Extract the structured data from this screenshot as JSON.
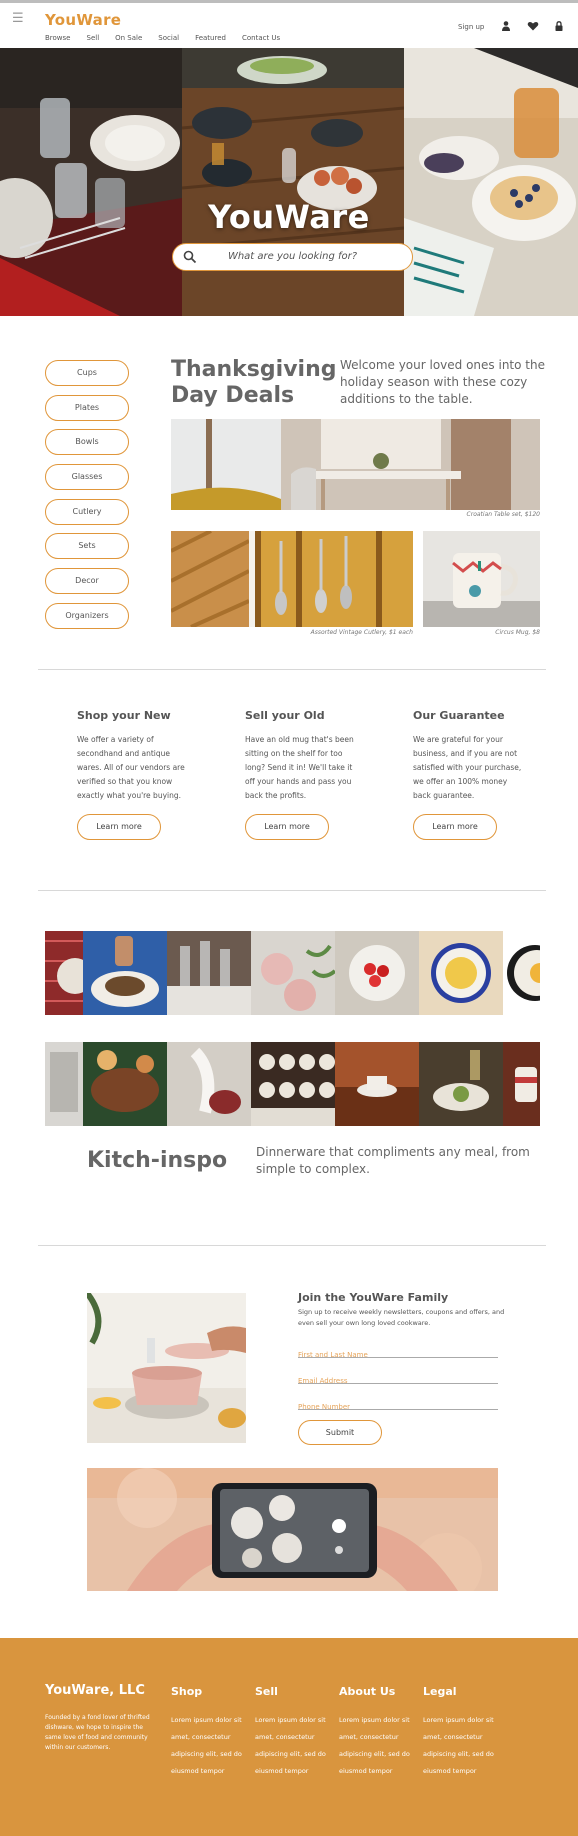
{
  "header": {
    "logo": "YouWare",
    "nav": [
      "Browse",
      "Sell",
      "On Sale",
      "Social",
      "Featured",
      "Contact Us"
    ],
    "signup": "Sign up",
    "icons": [
      "menu-icon",
      "user-icon",
      "heart-icon",
      "lock-icon"
    ]
  },
  "hero": {
    "title": "YouWare",
    "search_placeholder": "What are you looking for?"
  },
  "categories": [
    "Cups",
    "Plates",
    "Bowls",
    "Glasses",
    "Cutlery",
    "Sets",
    "Decor",
    "Organizers"
  ],
  "deals": {
    "title": "Thanksgiving Day Deals",
    "description": "Welcome your loved ones into the holiday season with these cozy additions to the table.",
    "captions": {
      "table": "Croatian Table set, $120",
      "cutlery": "Assorted Vintage Cutlery, $1 each",
      "mug": "Circus Mug, $8"
    }
  },
  "info": [
    {
      "title": "Shop your New",
      "body": "We offer a variety of secondhand and antique wares. All of our vendors are verified so that you know exactly what you're buying.",
      "button": "Learn more"
    },
    {
      "title": "Sell your Old",
      "body": "Have an old mug that's been sitting on the shelf for too long? Send it in! We'll take it off your hands and pass you back the profits.",
      "button": "Learn more"
    },
    {
      "title": "Our Guarantee",
      "body": "We are grateful for your business, and if you are not satisfied with your purchase, we offer an 100% money back guarantee.",
      "button": "Learn more"
    }
  ],
  "inspo": {
    "title": "Kitch-inspo",
    "description": "Dinnerware that compliments any meal, from simple to complex."
  },
  "join": {
    "title": "Join the YouWare Family",
    "description": "Sign up to receive weekly newsletters, coupons and offers, and even sell your own long loved cookware.",
    "fields": [
      "First and Last Name",
      "Email Address",
      "Phone Number"
    ],
    "submit": "Submit"
  },
  "footer": {
    "brand": "YouWare, LLC",
    "about": "Founded by a fond lover of thrifted dishware, we hope to inspire the same love of food and community within our customers.",
    "columns": [
      {
        "title": "Shop",
        "body": "Lorem ipsum dolor sit amet, consectetur adipiscing elit, sed do eiusmod tempor"
      },
      {
        "title": "Sell",
        "body": "Lorem ipsum dolor sit amet, consectetur adipiscing elit, sed do eiusmod tempor"
      },
      {
        "title": "About Us",
        "body": "Lorem ipsum dolor sit amet, consectetur adipiscing elit, sed do eiusmod tempor"
      },
      {
        "title": "Legal",
        "body": "Lorem ipsum dolor sit amet, consectetur adipiscing elit, sed do eiusmod tempor"
      }
    ]
  },
  "colors": {
    "accent": "#e0963a",
    "footer": "#d9953e",
    "text": "#555555"
  }
}
